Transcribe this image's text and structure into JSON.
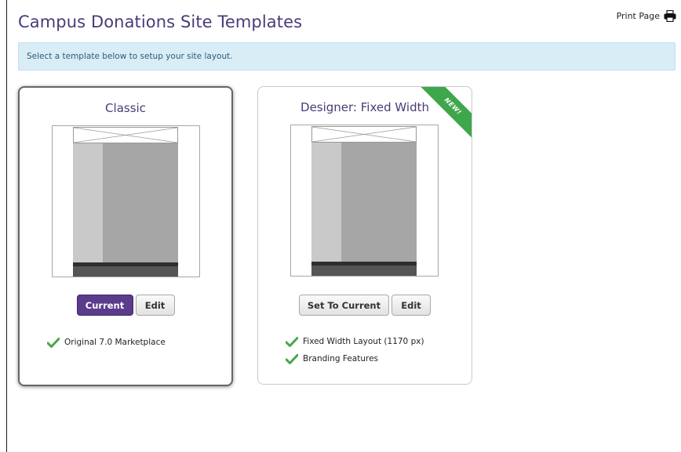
{
  "page": {
    "title": "Campus Donations Site Templates",
    "print_label": "Print Page",
    "info_message": "Select a template below to setup your site layout."
  },
  "templates": [
    {
      "name": "Classic",
      "status": "current",
      "buttons": {
        "primary": "Current",
        "edit": "Edit"
      },
      "features": [
        "Original 7.0 Marketplace"
      ]
    },
    {
      "name": "Designer: Fixed Width",
      "badge": "NEW!",
      "buttons": {
        "set_current": "Set To Current",
        "edit": "Edit"
      },
      "features": [
        "Fixed Width Layout (1170 px)",
        "Branding Features"
      ]
    }
  ],
  "colors": {
    "title": "#4b3a78",
    "primary_button": "#5b3b8c",
    "info_bg": "#d9edf7",
    "badge": "#3fa74b",
    "check": "#4aa54a"
  },
  "icons": {
    "print": "printer-icon",
    "check": "checkmark-icon"
  }
}
